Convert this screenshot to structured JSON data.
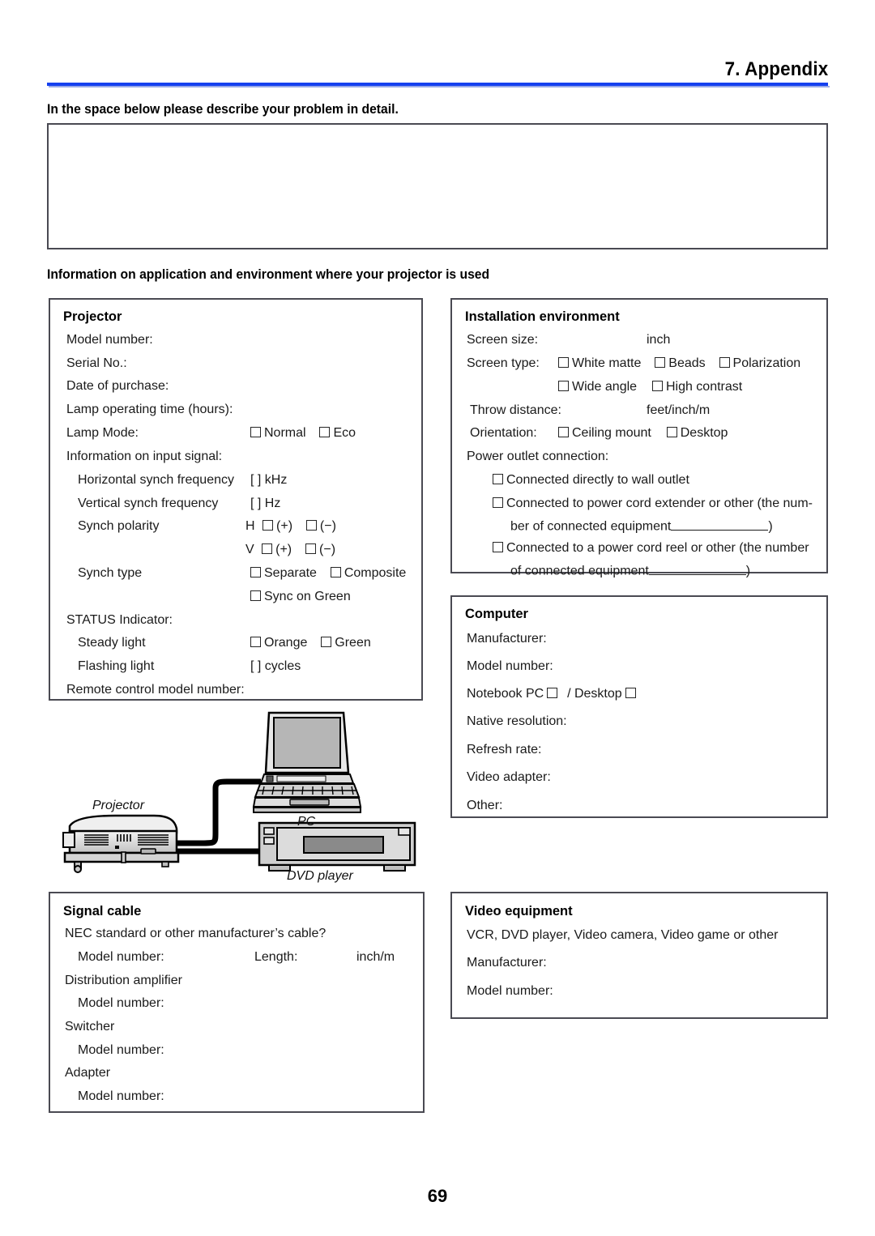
{
  "header": {
    "title": "7. Appendix",
    "rule_color": "#1540ef"
  },
  "headings": {
    "problem": "In the space below please describe your problem in detail.",
    "info": "Information on application and environment where your projector is used"
  },
  "projector": {
    "title": "Projector",
    "model_number": "Model number:",
    "serial_no": "Serial No.:",
    "date_of_purchase": "Date of purchase:",
    "lamp_operating_time": "Lamp operating time (hours):",
    "lamp_mode_label": "Lamp Mode:",
    "lamp_mode_normal": "Normal",
    "lamp_mode_eco": "Eco",
    "input_signal_label": "Information on input signal:",
    "h_sync_label": "Horizontal synch frequency",
    "h_sync_value": "[          ] kHz",
    "v_sync_label": "Vertical synch frequency",
    "v_sync_value": "[          ] Hz",
    "synch_polarity_label": "Synch polarity",
    "polarity_h_prefix": "H",
    "polarity_plus": "(+)",
    "polarity_minus": "(−)",
    "polarity_v_prefix": "V",
    "synch_type_label": "Synch type",
    "synch_type_separate": "Separate",
    "synch_type_composite": "Composite",
    "synch_type_sync_on_green": "Sync on Green",
    "status_indicator_label": "STATUS Indicator:",
    "steady_light_label": "Steady light",
    "steady_orange": "Orange",
    "steady_green": "Green",
    "flashing_light_label": "Flashing light",
    "flashing_value": "[          ] cycles",
    "remote_model_number": "Remote control model number:"
  },
  "installation": {
    "title": "Installation environment",
    "screen_size_label": "Screen size:",
    "screen_size_unit": "inch",
    "screen_type_label": "Screen type:",
    "screen_type_white_matte": "White matte",
    "screen_type_beads": "Beads",
    "screen_type_polarization": "Polarization",
    "screen_type_wide_angle": "Wide angle",
    "screen_type_high_contrast": "High contrast",
    "throw_distance_label": "Throw distance:",
    "throw_distance_unit": "feet/inch/m",
    "orientation_label": "Orientation:",
    "orientation_ceiling": "Ceiling mount",
    "orientation_desktop": "Desktop",
    "power_outlet_label": "Power outlet connection:",
    "power_opt1": "Connected directly to wall outlet",
    "power_opt2_line1": "Connected to power cord extender or other (the num-",
    "power_opt2_line2_pre": "ber of connected equipment",
    "power_opt2_line2_post": ")",
    "power_opt3_line1": "Connected to a power cord reel or other (the number",
    "power_opt3_line2_pre": "of connected equipment",
    "power_opt3_line2_post": ")"
  },
  "computer": {
    "title": "Computer",
    "manufacturer": "Manufacturer:",
    "model_number": "Model number:",
    "notebook_pc": "Notebook PC",
    "desktop_sep": "/ Desktop",
    "native_resolution": "Native resolution:",
    "refresh_rate": "Refresh rate:",
    "video_adapter": "Video adapter:",
    "other": "Other:"
  },
  "signal_cable": {
    "title": "Signal cable",
    "nec_question": "NEC standard or other manufacturer’s cable?",
    "model_number": "Model number:",
    "length_label": "Length:",
    "length_unit": "inch/m",
    "distribution_amplifier": "Distribution amplifier",
    "distribution_model_number": "Model number:",
    "switcher": "Switcher",
    "switcher_model_number": "Model number:",
    "adapter": "Adapter",
    "adapter_model_number": "Model number:"
  },
  "video_equipment": {
    "title": "Video equipment",
    "devices": "VCR, DVD player, Video camera, Video game or other",
    "manufacturer": "Manufacturer:",
    "model_number": "Model number:"
  },
  "diagram": {
    "projector_label": "Projector",
    "pc_label": "PC",
    "dvd_label": "DVD player"
  },
  "footer": {
    "page_number": "69"
  }
}
